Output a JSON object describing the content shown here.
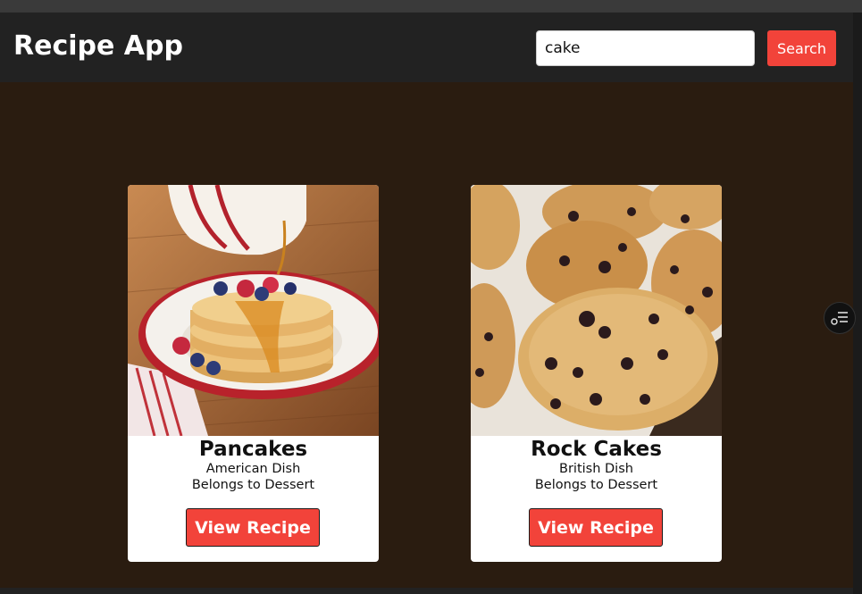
{
  "header": {
    "title": "Recipe App",
    "search": {
      "value": "cake",
      "button_label": "Search"
    }
  },
  "recipes": [
    {
      "name": "Pancakes",
      "cuisine": "American Dish",
      "category": "Belongs to Dessert",
      "button_label": "View Recipe"
    },
    {
      "name": "Rock Cakes",
      "cuisine": "British Dish",
      "category": "Belongs to Dessert",
      "button_label": "View Recipe"
    }
  ],
  "colors": {
    "accent": "#f2433a",
    "header_bg": "#222222",
    "page_bg": "#2a1c10",
    "card_bg": "#ffffff"
  },
  "icons": {
    "floating_button": "list-settings-icon"
  }
}
